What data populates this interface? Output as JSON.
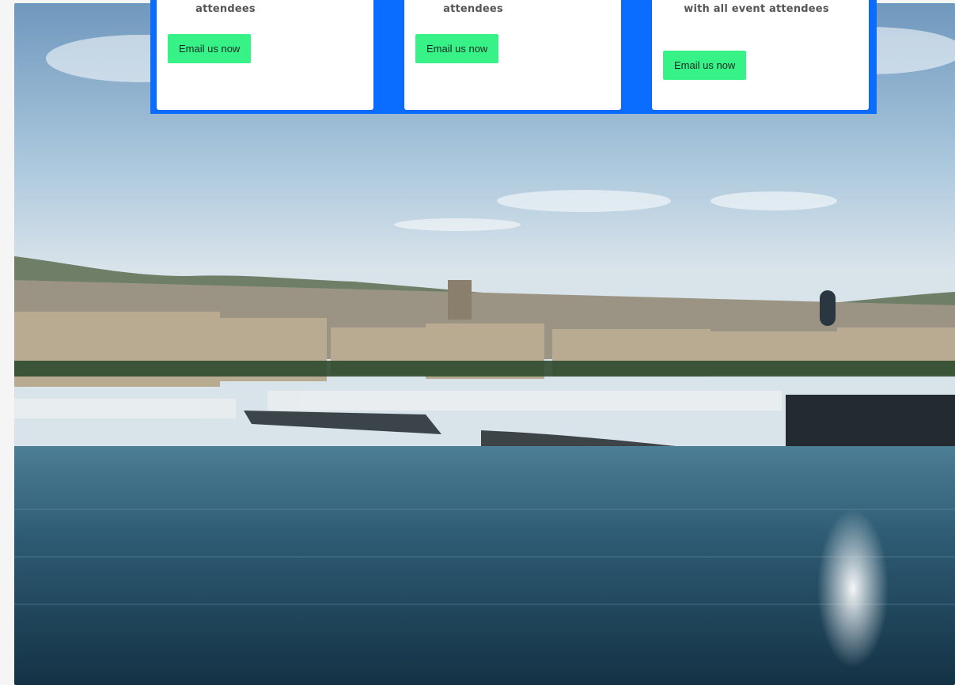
{
  "cards": [
    {
      "text": "attendees",
      "button_label": "Email us now"
    },
    {
      "text": "attendees",
      "button_label": "Email us now"
    },
    {
      "text": "with all event attendees",
      "button_label": "Email us now"
    }
  ],
  "colors": {
    "band": "#0a6dff",
    "button": "#37f387",
    "card_text": "#555555"
  },
  "hero": {
    "image": "harbor-city-skyline-photo"
  }
}
